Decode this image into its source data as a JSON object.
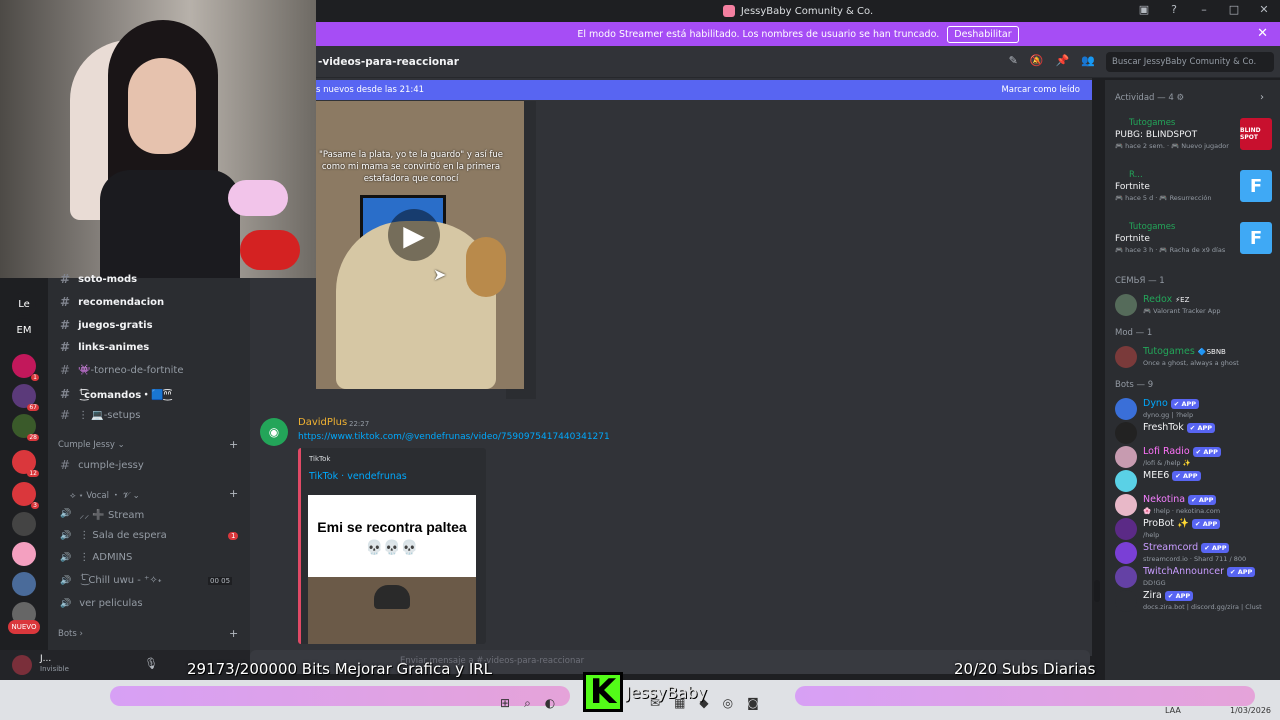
{
  "window": {
    "title": "JessyBaby Comunity & Co.",
    "controls": [
      "▣",
      "?",
      "–",
      "□",
      "✕"
    ]
  },
  "streamer_banner": {
    "text": "El modo Streamer está habilitado. Los nombres de usuario se han truncado.",
    "button": "Deshabilitar",
    "close": "✕"
  },
  "channel": {
    "name": "-videos-para-reaccionar",
    "search_placeholder": "Buscar JessyBaby Comunity & Co."
  },
  "new_messages_bar": {
    "text": "s nuevos desde las 21:41",
    "action": "Marcar como leído"
  },
  "video1": {
    "caption": "\"Pasame la plata, yo te la guardo\" y así fue como mi mama se convirtió en la primera estafadora que conocí"
  },
  "message2": {
    "author": "DavidPlus",
    "time": "22:27",
    "link": "https://www.tiktok.com/@vendefrunas/video/7590975417440341271",
    "embed_provider": "TikTok",
    "embed_title": "TikTok · vendefrunas",
    "embed_caption": "Emi se recontra paltea",
    "embed_emoji": "💀💀💀"
  },
  "composer": {
    "placeholder": "Enviar mensaje a #-videos-para-reaccionar"
  },
  "guilds": [
    {
      "label": "Le",
      "color": "#1e1f22",
      "badge": ""
    },
    {
      "label": "EM",
      "color": "#1e1f22",
      "badge": ""
    },
    {
      "label": "",
      "color": "#c2185b",
      "badge": "1"
    },
    {
      "label": "",
      "color": "#5b3a7a",
      "badge": "67"
    },
    {
      "label": "",
      "color": "#3a5a2a",
      "badge": "28"
    },
    {
      "label": "",
      "color": "#da373c",
      "badge": "12"
    },
    {
      "label": "",
      "color": "#da373c",
      "badge": "3"
    },
    {
      "label": "",
      "color": "#444",
      "badge": ""
    },
    {
      "label": "",
      "color": "#f4a0c0",
      "badge": ""
    },
    {
      "label": "",
      "color": "#4a6b9a",
      "badge": ""
    },
    {
      "label": "",
      "color": "#666",
      "badge": ""
    },
    {
      "label": "NUEVO",
      "color": "#da373c",
      "badge": ""
    }
  ],
  "sidebar": {
    "channels": [
      {
        "name": "soto-mods",
        "type": "text",
        "bold": true
      },
      {
        "name": "recomendacion",
        "type": "text",
        "bold": true
      },
      {
        "name": "juegos-gratis",
        "type": "text",
        "bold": true
      },
      {
        "name": "links-animes",
        "type": "text",
        "bold": true
      },
      {
        "name": "👾-torneo-de-fortnite",
        "type": "text",
        "bold": false
      },
      {
        "name": "╰͜͡comandos・🟦ᐢ͏͜͡ᐢ",
        "type": "text",
        "bold": true
      },
      {
        "name": "⋮ 💻-setups",
        "type": "text",
        "bold": false
      }
    ],
    "category_cumple": "Cumple Jessy ⌄",
    "cumple_channel": "cumple-jessy",
    "category_voice": "⟡ ⋆ Vocal ・ 𝓥 ⌄",
    "voice_channels": [
      {
        "name": "⸝⸝ ➕ Stream",
        "badge": "",
        "counts": ""
      },
      {
        "name": "⋮ Sala de espera",
        "badge": "1",
        "counts": ""
      },
      {
        "name": "⋮ ADMINS",
        "badge": "",
        "counts": ""
      },
      {
        "name": "╰͜͡ Chill uwu - ⁺✧˖",
        "badge": "",
        "counts": "00  05"
      },
      {
        "name": "ver peliculas",
        "badge": "",
        "counts": ""
      }
    ],
    "category_bots": "Bots ›"
  },
  "user_panel": {
    "name": "J...",
    "status": "Invisible"
  },
  "activity": {
    "header": "Actividad — 4 ⚙",
    "items": [
      {
        "who": "Tutogames",
        "game": "PUBG: BLINDSPOT",
        "meta": "🎮 hace 2 sem. · 🎮 Nuevo jugador",
        "thumb": "BLIND SPOT",
        "thumb_color": "#c8102e"
      },
      {
        "who": "R...",
        "game": "Fortnite",
        "meta": "🎮 hace 5 d · 🎮 Resurrección",
        "thumb": "F",
        "thumb_color": "#3fa9f5"
      },
      {
        "who": "Tutogames",
        "game": "Fortnite",
        "meta": "🎮 hace 3 h · 🎮 Racha de x9 días",
        "thumb": "F",
        "thumb_color": "#3fa9f5"
      }
    ]
  },
  "members": {
    "sections": [
      {
        "title": "СЕМЬЯ — 1",
        "members": [
          {
            "name": "Redox",
            "tag": "⚡EZ",
            "sub": "🎮 Valorant Tracker App",
            "color": "#23a559",
            "app": false,
            "av": "#556b5a"
          }
        ]
      },
      {
        "title": "Mod — 1",
        "members": [
          {
            "name": "Tutogames",
            "tag": "🔷SBNB",
            "sub": "Once a ghost, always a ghost",
            "color": "#23a559",
            "app": false,
            "av": "#7a3a3a"
          }
        ]
      },
      {
        "title": "Bots — 9",
        "members": [
          {
            "name": "Dyno",
            "tag": "",
            "sub": "dyno.gg | ?help",
            "color": "#00a8fc",
            "app": true,
            "av": "#3a6fd8"
          },
          {
            "name": "FreshTok",
            "tag": "",
            "sub": "",
            "color": "#f2f3f5",
            "app": true,
            "av": "#222"
          },
          {
            "name": "Lofi Radio",
            "tag": "",
            "sub": "/lofi & /help ✨",
            "color": "#ff73fa",
            "app": true,
            "av": "#c79bb0"
          },
          {
            "name": "MEE6",
            "tag": "",
            "sub": "",
            "color": "#f2f3f5",
            "app": true,
            "av": "#5ad1e6"
          },
          {
            "name": "Nekotina",
            "tag": "",
            "sub": "🌸 !help · nekotina.com",
            "color": "#f47fff",
            "app": true,
            "av": "#e8b8c8"
          },
          {
            "name": "ProBot ✨",
            "tag": "",
            "sub": "/help",
            "color": "#f2f3f5",
            "app": true,
            "av": "#5b2a86"
          },
          {
            "name": "Streamcord",
            "tag": "",
            "sub": "streamcord.io · Shard 711 / 800",
            "color": "#c89cff",
            "app": true,
            "av": "#7a3fd6"
          },
          {
            "name": "TwitchAnnouncer",
            "tag": "",
            "sub": "DD!GG",
            "color": "#c89cff",
            "app": true,
            "av": "#6441a5"
          },
          {
            "name": "Zira",
            "tag": "",
            "sub": "docs.zira.bot | discord.gg/zira | Clust",
            "color": "#f2f3f5",
            "app": true,
            "av": "#2b2d31"
          }
        ]
      }
    ],
    "app_label": "✔ APP"
  },
  "stream_overlay": {
    "left_text": "29173/200000 Bits Mejorar Grafica y IRL",
    "right_text": "20/20 Subs Diarias",
    "kick_letter": "K",
    "kick_name": "JessyBaby"
  },
  "taskbar": {
    "lang": "LAA",
    "date": "1/03/2026"
  }
}
